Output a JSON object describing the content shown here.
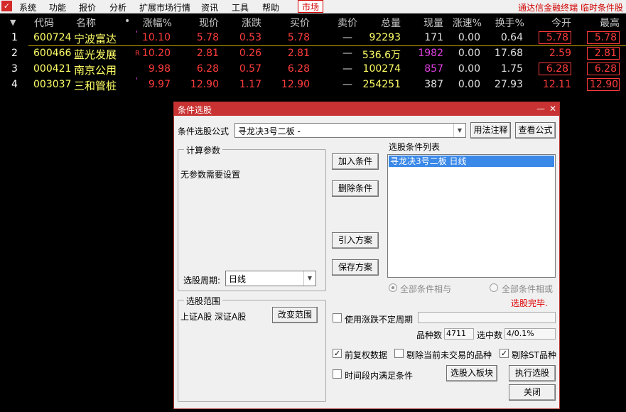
{
  "menu": {
    "logo": "✓",
    "items": [
      "系统",
      "功能",
      "报价",
      "分析",
      "扩展市场行情",
      "资讯",
      "工具",
      "帮助"
    ],
    "market": "市场",
    "right": "通达信金融终端  临时条件股"
  },
  "table": {
    "headers": [
      "代码",
      "名称",
      "•",
      "涨幅%",
      "现价",
      "涨跌",
      "买价",
      "卖价",
      "总量",
      "现量",
      "涨速%",
      "换手%",
      "今开",
      "最高"
    ],
    "rows": [
      {
        "idx": "1",
        "code": "600724",
        "name": "宁波富达",
        "flag": "'",
        "chg_pct": "10.10",
        "price": "5.78",
        "chg": "0.53",
        "bid": "5.78",
        "ask": "—",
        "vol": "92293",
        "cur_vol": "171",
        "speed": "0.00",
        "turnover": "0.64",
        "open": "5.78",
        "high": "5.78"
      },
      {
        "idx": "2",
        "code": "600466",
        "name": "蓝光发展",
        "flag": "R",
        "chg_pct": "10.20",
        "price": "2.81",
        "chg": "0.26",
        "bid": "2.81",
        "ask": "—",
        "vol": "536.6万",
        "cur_vol": "1982",
        "speed": "0.00",
        "turnover": "17.68",
        "open": "2.59",
        "high": "2.81"
      },
      {
        "idx": "3",
        "code": "000421",
        "name": "南京公用",
        "flag": "",
        "chg_pct": "9.98",
        "price": "6.28",
        "chg": "0.57",
        "bid": "6.28",
        "ask": "—",
        "vol": "100274",
        "cur_vol": "857",
        "speed": "0.00",
        "turnover": "1.75",
        "open": "6.28",
        "high": "6.28"
      },
      {
        "idx": "4",
        "code": "003037",
        "name": "三和管桩",
        "flag": "'",
        "chg_pct": "9.97",
        "price": "12.90",
        "chg": "1.17",
        "bid": "12.90",
        "ask": "—",
        "vol": "254251",
        "cur_vol": "387",
        "speed": "0.00",
        "turnover": "27.93",
        "open": "12.11",
        "high": "12.90"
      }
    ]
  },
  "dialog": {
    "title": "条件选股",
    "min_icon": "—",
    "close_icon": "✕",
    "formula_label": "条件选股公式",
    "formula_value": "寻龙决3号二板 -",
    "usage_btn": "用法注释",
    "view_formula_btn": "查看公式",
    "params_group": "计算参数",
    "params_text": "无参数需要设置",
    "period_label": "选股周期:",
    "period_value": "日线",
    "range_group": "选股范围",
    "range_text": "上证A股  深证A股",
    "change_range_btn": "改变范围",
    "add_cond_btn": "加入条件",
    "del_cond_btn": "删除条件",
    "import_btn": "引入方案",
    "save_btn": "保存方案",
    "cond_list_label": "选股条件列表",
    "cond_list_items": [
      "寻龙决3号二板  日线"
    ],
    "radio_and": "全部条件相与",
    "radio_or": "全部条件相或",
    "status": "选股完毕.",
    "use_variable_period": "使用涨跌不定周期",
    "count_label": "品种数",
    "count_value": "4711",
    "selected_label": "选中数",
    "selected_value": "4/0.1%",
    "forward_adjust": "前复权数据",
    "exclude_untraded": "剔除当前未交易的品种",
    "exclude_st": "剔除ST品种",
    "time_range": "时间段内满足条件",
    "to_block_btn": "选股入板块",
    "execute_btn": "执行选股",
    "close_btn": "关闭",
    "check_mark": "✓"
  }
}
